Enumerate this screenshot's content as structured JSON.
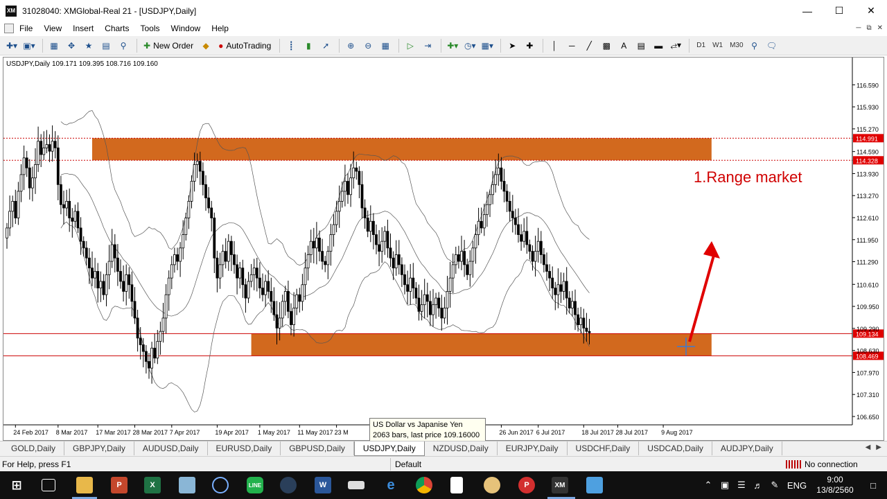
{
  "window": {
    "title": "31028040: XMGlobal-Real 21 - [USDJPY,Daily]",
    "logo": "XM"
  },
  "menu": [
    "File",
    "View",
    "Insert",
    "Charts",
    "Tools",
    "Window",
    "Help"
  ],
  "toolbar": {
    "new_order": "New Order",
    "autotrading": "AutoTrading",
    "periods": [
      "D1",
      "W1",
      "M30"
    ]
  },
  "chart": {
    "header": "USDJPY,Daily  109.171 109.395 108.716 109.160",
    "annotation": "1.Range market",
    "tooltip_line1": "US Dollar vs Japanise Yen",
    "tooltip_line2": "2063 bars, last price 109.16000",
    "colors": {
      "zone": "#d2691e",
      "bull": "#ffffff",
      "bear": "#000000",
      "arrow": "#e00000",
      "level_bg": "#e00000",
      "annotation": "#d00000"
    }
  },
  "chart_data": {
    "type": "candlestick",
    "symbol": "USDJPY",
    "timeframe": "Daily",
    "ylim": [
      106.4,
      117.2
    ],
    "y_ticks": [
      116.59,
      115.93,
      115.27,
      114.59,
      113.93,
      113.27,
      112.61,
      111.95,
      111.29,
      110.61,
      109.95,
      109.29,
      108.63,
      107.97,
      107.31,
      106.65
    ],
    "y_tick_labels": [
      "116.590",
      "115.930",
      "115.270",
      "114.590",
      "113.930",
      "113.270",
      "112.610",
      "111.950",
      "111.290",
      "110.610",
      "109.950",
      "109.290",
      "108.630",
      "107.970",
      "107.310",
      "106.650"
    ],
    "price_levels": [
      {
        "value": 114.991,
        "label": "114.991",
        "style": "dotted"
      },
      {
        "value": 114.328,
        "label": "114.328",
        "style": "dotted"
      },
      {
        "value": 109.134,
        "label": "109.134",
        "style": "solid"
      },
      {
        "value": 108.469,
        "label": "108.469",
        "style": "solid"
      }
    ],
    "zones": [
      {
        "from_bar": 30,
        "to_bar": 248,
        "low": 114.328,
        "high": 114.991
      },
      {
        "from_bar": 86,
        "to_bar": 248,
        "low": 108.469,
        "high": 109.134
      }
    ],
    "x_labels": [
      {
        "bar": 3,
        "label": "24 Feb 2017"
      },
      {
        "bar": 18,
        "label": "8 Mar 2017"
      },
      {
        "bar": 32,
        "label": "17 Mar 2017"
      },
      {
        "bar": 45,
        "label": "28 Mar 2017"
      },
      {
        "bar": 58,
        "label": "7 Apr 2017"
      },
      {
        "bar": 74,
        "label": "19 Apr 2017"
      },
      {
        "bar": 89,
        "label": "1 May 2017"
      },
      {
        "bar": 103,
        "label": "11 May 2017"
      },
      {
        "bar": 116,
        "label": "23 M"
      },
      {
        "bar": 174,
        "label": "26 Jun 2017"
      },
      {
        "bar": 187,
        "label": "6 Jul 2017"
      },
      {
        "bar": 203,
        "label": "18 Jul 2017"
      },
      {
        "bar": 215,
        "label": "28 Jul 2017"
      },
      {
        "bar": 231,
        "label": "9 Aug 2017"
      }
    ],
    "closes": [
      112.3,
      112.8,
      113.1,
      112.6,
      113.4,
      113.9,
      114.4,
      114.1,
      113.5,
      113.8,
      114.2,
      114.9,
      114.5,
      114.7,
      114.8,
      114.6,
      114.9,
      114.7,
      113.6,
      113.0,
      112.9,
      113.1,
      112.6,
      112.5,
      112.8,
      112.3,
      111.9,
      111.7,
      111.4,
      111.1,
      110.8,
      111.0,
      110.5,
      110.7,
      110.3,
      110.9,
      111.3,
      111.8,
      111.4,
      111.0,
      110.7,
      110.4,
      110.9,
      110.6,
      110.1,
      109.6,
      109.0,
      108.8,
      108.6,
      108.3,
      108.1,
      108.7,
      108.4,
      108.9,
      109.2,
      109.6,
      110.3,
      110.8,
      111.2,
      111.5,
      111.3,
      111.7,
      112.1,
      112.6,
      113.1,
      113.7,
      114.2,
      114.3,
      114.0,
      113.6,
      113.2,
      112.9,
      112.6,
      111.4,
      110.8,
      111.2,
      111.6,
      111.3,
      111.9,
      111.5,
      111.2,
      110.8,
      111.1,
      110.6,
      110.2,
      110.7,
      110.9,
      111.1,
      110.8,
      110.5,
      110.3,
      110.7,
      110.4,
      110.1,
      109.7,
      109.3,
      109.6,
      110.1,
      110.4,
      109.8,
      109.4,
      109.9,
      110.3,
      110.1,
      110.6,
      111.1,
      111.5,
      111.9,
      111.7,
      112.0,
      111.6,
      111.3,
      111.2,
      111.6,
      112.1,
      112.4,
      112.8,
      113.1,
      113.4,
      113.7,
      113.3,
      113.8,
      114.1,
      114.0,
      113.6,
      112.9,
      112.6,
      112.2,
      112.5,
      112.1,
      111.8,
      111.6,
      111.9,
      112.2,
      111.7,
      111.4,
      111.1,
      111.5,
      111.2,
      110.9,
      110.6,
      110.4,
      110.8,
      110.5,
      110.2,
      109.8,
      110.0,
      110.3,
      110.1,
      109.7,
      110.0,
      110.2,
      109.9,
      109.6,
      109.9,
      110.4,
      110.8,
      111.2,
      111.5,
      111.3,
      111.6,
      111.2,
      110.9,
      111.3,
      111.7,
      112.1,
      112.5,
      112.3,
      112.7,
      113.0,
      113.3,
      113.6,
      113.9,
      114.1,
      113.7,
      113.4,
      113.1,
      112.8,
      112.6,
      112.4,
      112.1,
      111.9,
      112.2,
      111.8,
      111.6,
      111.3,
      111.6,
      111.9,
      111.5,
      111.2,
      111.0,
      110.8,
      110.5,
      110.3,
      110.6,
      110.4,
      110.7,
      110.2,
      109.9,
      110.1,
      109.7,
      109.4,
      109.6,
      109.3,
      109.2,
      109.16
    ]
  },
  "tabs": [
    "GOLD,Daily",
    "GBPJPY,Daily",
    "AUDUSD,Daily",
    "EURUSD,Daily",
    "GBPUSD,Daily",
    "USDJPY,Daily",
    "NZDUSD,Daily",
    "EURJPY,Daily",
    "USDCHF,Daily",
    "USDCAD,Daily",
    "AUDJPY,Daily"
  ],
  "status": {
    "help": "For Help, press F1",
    "profile": "Default",
    "connection": "No connection"
  },
  "taskbar": {
    "lang": "ENG",
    "time": "9:00",
    "date": "13/8/2560"
  }
}
